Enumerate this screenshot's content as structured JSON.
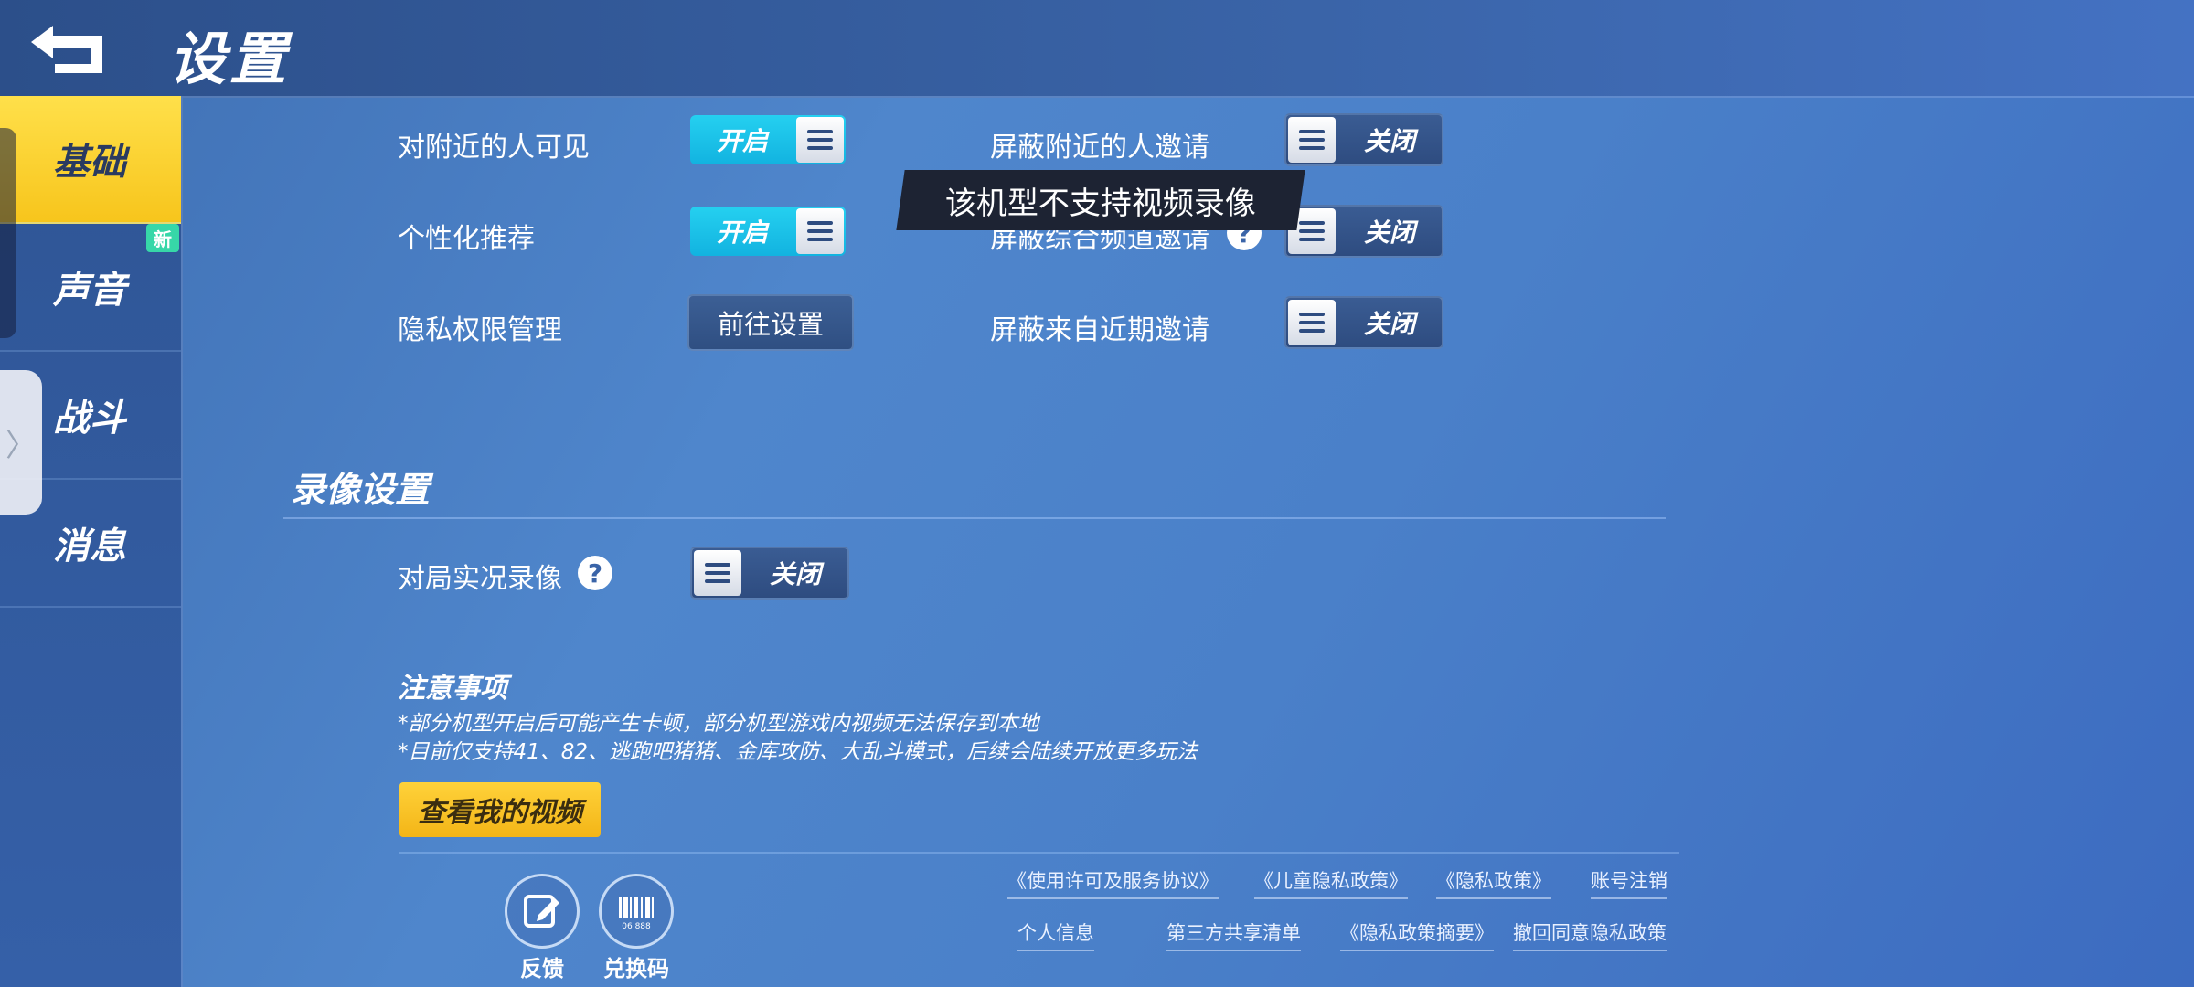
{
  "header": {
    "title": "设置"
  },
  "sidebar": {
    "items": [
      {
        "label": "基础",
        "active": true
      },
      {
        "label": "声音",
        "badge": "新"
      },
      {
        "label": "战斗"
      },
      {
        "label": "消息"
      }
    ],
    "pull_tab_glyph": "〉"
  },
  "privacy": {
    "nearby_visible": {
      "label": "对附近的人可见",
      "state": "开启"
    },
    "personalized": {
      "label": "个性化推荐",
      "state": "开启"
    },
    "permission": {
      "label": "隐私权限管理",
      "button": "前往设置"
    },
    "block_nearby": {
      "label": "屏蔽附近的人邀请",
      "state": "关闭"
    },
    "block_channel": {
      "label": "屏蔽综合频道邀请",
      "state": "关闭"
    },
    "block_recent": {
      "label": "屏蔽来自近期邀请",
      "state": "关闭"
    }
  },
  "toast": "该机型不支持视频录像",
  "recording": {
    "section_title": "录像设置",
    "live_record": {
      "label": "对局实况录像",
      "state": "关闭"
    },
    "notes_title": "注意事项",
    "notes": [
      "*部分机型开启后可能产生卡顿，部分机型游戏内视频无法保存到本地",
      "*目前仅支持41、82、逃跑吧猪猪、金库攻防、大乱斗模式，后续会陆续开放更多玩法"
    ],
    "view_button": "查看我的视频"
  },
  "footer": {
    "feedback": "反馈",
    "redeem": "兑换码",
    "barcode_number": "06 888",
    "links_row1": [
      "《使用许可及服务协议》",
      "《儿童隐私政策》",
      "《隐私政策》",
      "账号注销"
    ],
    "links_row2": [
      "个人信息",
      "第三方共享清单",
      "《隐私政策摘要》",
      "撤回同意隐私政策"
    ]
  },
  "help_glyph": "?",
  "colors": {
    "accent_yellow": "#f7c51c",
    "toggle_on": "#12b3e0",
    "bg_blue": "#4a80c9"
  }
}
